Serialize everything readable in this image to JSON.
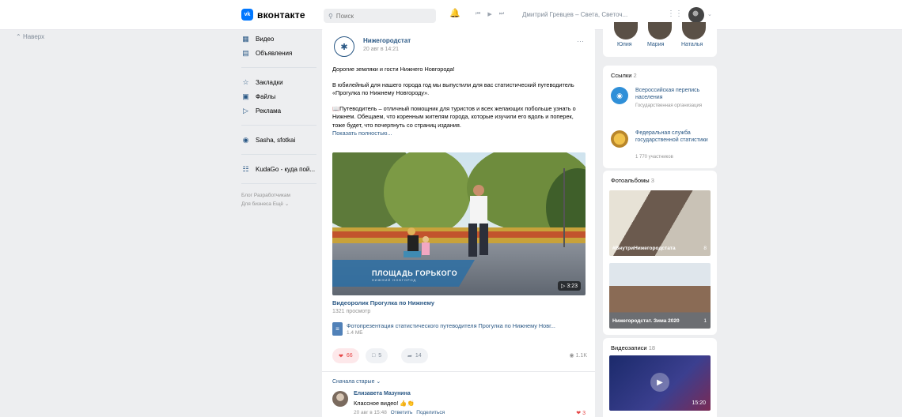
{
  "header": {
    "logo_text": "вконтакте",
    "logo_badge": "vk",
    "search_placeholder": "Поиск",
    "now_playing": "Дмитрий Гревцев – Света, Светоч..."
  },
  "scroll_top": "Наверх",
  "left_nav": {
    "items": [
      {
        "label": "Видео",
        "icon": "video-icon"
      },
      {
        "label": "Объявления",
        "icon": "ads-icon"
      },
      {
        "label": "Закладки",
        "icon": "star-icon"
      },
      {
        "label": "Файлы",
        "icon": "file-icon"
      },
      {
        "label": "Реклама",
        "icon": "megaphone-icon"
      },
      {
        "label": "Sasha, sfotkai",
        "icon": "community-icon"
      },
      {
        "label": "KudaGo - куда пой...",
        "icon": "apps-icon"
      }
    ],
    "footer_line1": "Блог  Разработчикам",
    "footer_line2": "Для бизнеса  Ещё ⌄"
  },
  "post": {
    "author": "Нижегородстат",
    "date": "20 авг в 14:21",
    "text_p1": "Дорогие земляки и гости Нижнего Новгорода!",
    "text_p2": "В юбилейный для нашего города год мы выпустили для вас статистический путеводитель «Прогулка по Нижнему Новгороду».",
    "text_p3": "📖Путеводитель – отличный помощник для туристов и всех желающих побольше узнать о Нижнем. Обещаем, что коренным жителям города, которые изучили его вдоль и поперек, тоже будет, что почерпнуть со страниц издания.",
    "show_more": "Показать полностью...",
    "video": {
      "caption_main": "ПЛОЩАДЬ ГОРЬКОГО",
      "caption_sub": "НИЖНИЙ НОВГОРОД",
      "duration": "3:23",
      "title": "Видеоролик Прогулка по Нижнему",
      "views": "1321 просмотр"
    },
    "doc": {
      "title": "Фотопрезентация статистического путеводителя Прогулка по Нижнему Новг...",
      "size": "1.4 МБ"
    },
    "likes": "66",
    "comments": "5",
    "shares": "14",
    "views": "1.1K",
    "sort_label": "Сначала старые ⌄",
    "comment": {
      "author": "Елизавета Мазунина",
      "text": "Классное видео! 👍👏",
      "date": "20 авг в 15:48",
      "reply": "Ответить",
      "share": "Поделиться",
      "likes": "3"
    }
  },
  "friends": [
    {
      "name": "Юлия"
    },
    {
      "name": "Мария"
    },
    {
      "name": "Наталья"
    }
  ],
  "links": {
    "title": "Ссылки",
    "count": "2",
    "items": [
      {
        "title": "Всероссийская перепись населения",
        "subtitle": "Государственная организация"
      },
      {
        "title": "Федеральная служба государственной статистики",
        "subtitle": "1 770 участников"
      }
    ]
  },
  "albums": {
    "title": "Фотоальбомы",
    "count": "3",
    "items": [
      {
        "title": "#ВнутриНижегородстата",
        "count": "8"
      },
      {
        "title": "Нижегородстат. Зима 2020",
        "count": "1"
      }
    ]
  },
  "videos": {
    "title": "Видеозаписи",
    "count": "18",
    "duration": "15:20"
  }
}
